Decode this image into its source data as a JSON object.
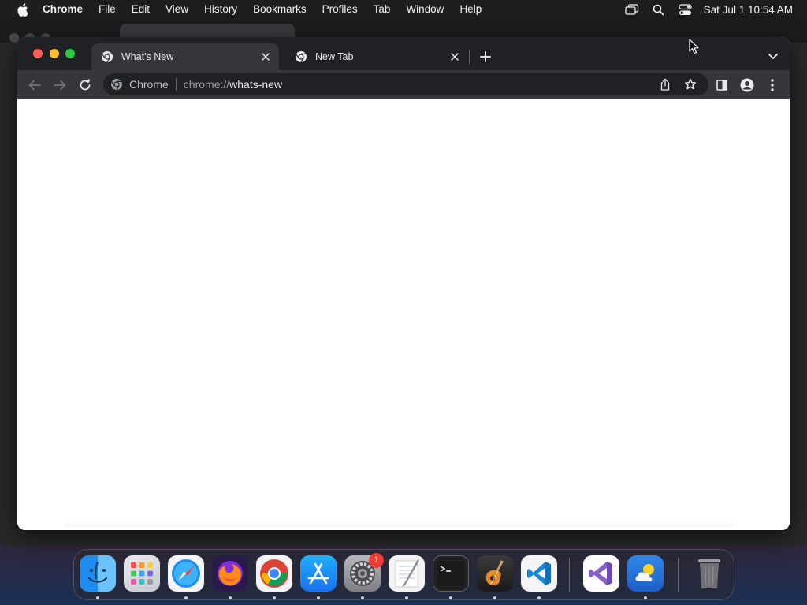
{
  "menubar": {
    "app_name": "Chrome",
    "items": [
      "File",
      "Edit",
      "View",
      "History",
      "Bookmarks",
      "Profiles",
      "Tab",
      "Window",
      "Help"
    ],
    "clock": "Sat Jul 1  10:54 AM",
    "status_icons": [
      "screen-mirroring-icon",
      "spotlight-search-icon",
      "control-center-icon"
    ]
  },
  "browser": {
    "tabs": [
      {
        "title": "What's New",
        "active": true,
        "icon": "chrome-icon"
      },
      {
        "title": "New Tab",
        "active": false,
        "icon": "chrome-icon"
      }
    ],
    "omnibox": {
      "site_label": "Chrome",
      "url_scheme": "chrome://",
      "url_host": "whats-new"
    }
  },
  "dock": {
    "apps": [
      "Finder",
      "Launchpad",
      "Safari",
      "Firefox",
      "Google Chrome",
      "App Store",
      "System Settings",
      "TextEdit",
      "Terminal",
      "GarageBand",
      "Visual Studio Code",
      "Visual Studio",
      "Weather",
      "Trash"
    ],
    "system_settings_badge": "1"
  },
  "colors": {
    "tabstrip_bg": "#202124",
    "toolbar_bg": "#35363a",
    "menubar_bg": "#1d1d20",
    "close_red": "#ff5f57",
    "minimize_yellow": "#febc2e",
    "zoom_green": "#28c840",
    "badge_red": "#f23b30"
  }
}
